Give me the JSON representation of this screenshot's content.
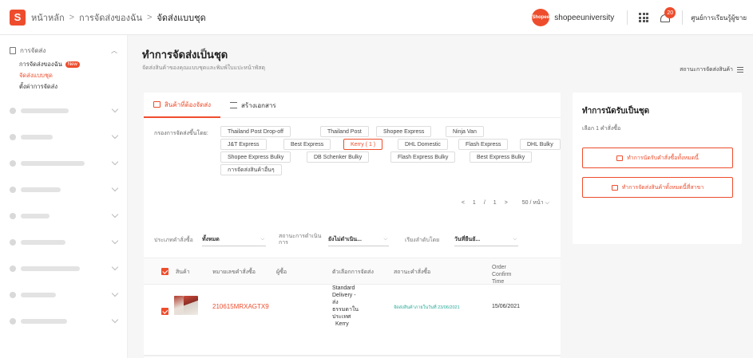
{
  "header": {
    "logo_text": "S",
    "breadcrumb": [
      "หน้าหลัก",
      "การจัดส่งของฉัน",
      "จัดส่งแบบชุด"
    ],
    "separator": ">",
    "avatar_text": "Shopee",
    "username": "shopeeuniversity",
    "notification_count": "20",
    "help_label": "ศูนย์การเรียนรู้ผู้ขาย"
  },
  "sidebar": {
    "section_title": "การจัดส่ง",
    "items": [
      {
        "label": "การจัดส่งของฉัน",
        "badge": "New"
      },
      {
        "label": "จัดส่งแบบชุด"
      },
      {
        "label": "ตั้งค่าการจัดส่ง"
      }
    ]
  },
  "main": {
    "title": "ทำการจัดส่งเป็นชุด",
    "subtitle": "จัดส่งสินค้าของคุณแบบชุดและพิมพ์ใบแปะหน้าพัสดุ",
    "status_button": "สถานะการจัดส่งสินค้า"
  },
  "tabs": [
    {
      "label": "สินค้าที่ต้องจัดส่ง"
    },
    {
      "label": "สร้างเอกสาร"
    }
  ],
  "filter_label": "กรองการจัดส่งขึ้นโดย:",
  "couriers": [
    "Thailand Post Drop-off",
    "Thailand Post",
    "Shopee Express",
    "Ninja Van",
    "J&T Express",
    "Best Express",
    "Kerry ( 1 )",
    "DHL Domestic",
    "Flash Express",
    "DHL Bulky",
    "Shopee Express Bulky",
    "DB Schenker Bulky",
    "Flash Express Bulky",
    "Best Express Bulky",
    "การจัดส่งสินค้าอื่นๆ"
  ],
  "pagination": {
    "prev": "<",
    "current": "1",
    "slash": "/",
    "total": "1",
    "next": ">",
    "per_page": "50 / หน้า"
  },
  "filters": {
    "order_type_label": "ประเภทคำสั่งซื้อ",
    "order_type_value": "ทั้งหมด",
    "process_label": "สถานะการดำเนินการ",
    "process_value": "ยังไม่ดำเนิน...",
    "sort_label": "เรียงลำดับโดย",
    "sort_value": "วันที่ยืนยั..."
  },
  "table": {
    "headers": [
      "สินค้า",
      "หมายเลขคำสั่งซื้อ",
      "ผู้ซื้อ",
      "ตัวเลือกการจัดส่ง",
      "สถานะคำสั่งซื้อ",
      "Order Confirm Time"
    ],
    "rows": [
      {
        "order_id": "210615MRXAGTX9",
        "shipping_lines": [
          "Standard",
          "Delivery - ส่ง",
          "ธรรมดาใน",
          "ประเทศ",
          "Kerry"
        ],
        "status": "จัดส่งสินค้าภายในวันที่ 23/06/2021",
        "confirm_time": "15/06/2021"
      }
    ]
  },
  "right_panel": {
    "title": "ทำการนัดรับเป็นชุด",
    "selected_text": "เลือก 1 คำสั่งซื้อ",
    "button1": "ทำการนัดรับคำสั่งซื้อทั้งหมดนี้",
    "button2": "ทำการจัดส่งสินค้าทั้งหมดนี้ที่สาขา"
  },
  "colors": {
    "accent": "#ee4d2d",
    "status_green": "#26aa99"
  }
}
